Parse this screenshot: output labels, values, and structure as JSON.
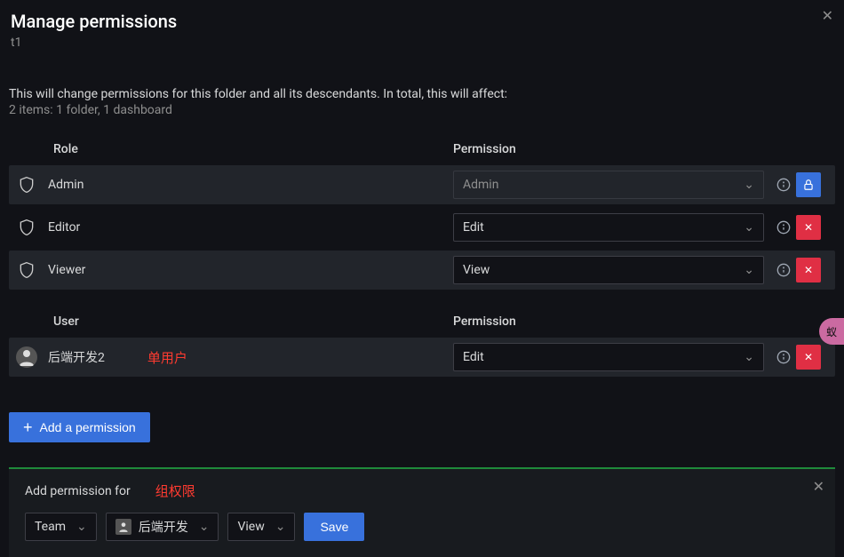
{
  "header": {
    "title": "Manage permissions",
    "sub": "t1"
  },
  "warning": {
    "line1": "This will change permissions for this folder and all its descendants. In total, this will affect:",
    "line2": "2 items: 1 folder, 1 dashboard"
  },
  "roles": {
    "col_role": "Role",
    "col_perm": "Permission",
    "rows": [
      {
        "name": "Admin",
        "perm": "Admin",
        "locked": true,
        "disabled": true
      },
      {
        "name": "Editor",
        "perm": "Edit",
        "locked": false,
        "disabled": false
      },
      {
        "name": "Viewer",
        "perm": "View",
        "locked": false,
        "disabled": false
      }
    ]
  },
  "users": {
    "col_user": "User",
    "col_perm": "Permission",
    "rows": [
      {
        "name": "后端开发2",
        "annotation": "单用户",
        "perm": "Edit"
      }
    ]
  },
  "add_button": "Add a permission",
  "panel": {
    "title": "Add permission for",
    "annotation": "组权限",
    "type_select": "Team",
    "team_select": "后端开发",
    "perm_select": "View",
    "save": "Save"
  }
}
